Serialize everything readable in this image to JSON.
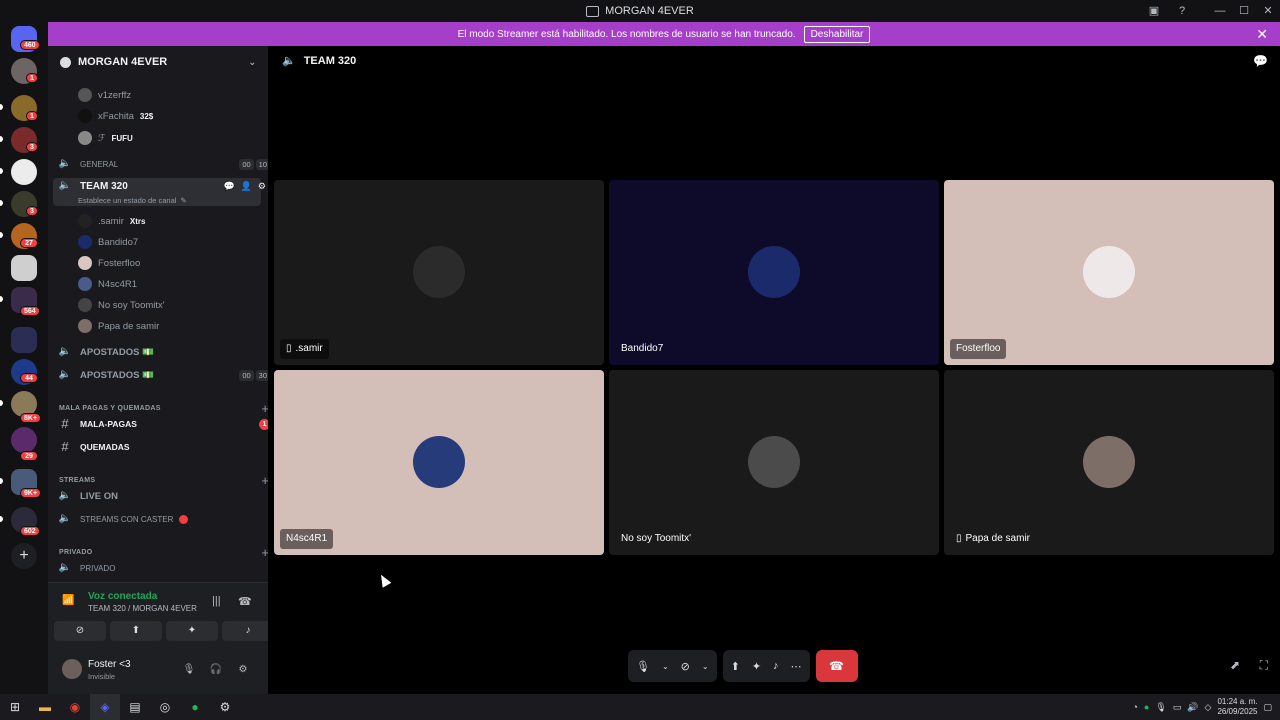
{
  "window": {
    "title": "MORGAN 4EVER"
  },
  "banner": {
    "text": "El modo Streamer está habilitado. Los nombres de usuario se han truncado.",
    "button": "Deshabilitar"
  },
  "servers": [
    {
      "badge": "460"
    },
    {
      "badge": "1"
    },
    {
      "badge": "1"
    },
    {
      "badge": "3"
    },
    {
      "badge": ""
    },
    {
      "badge": "3"
    },
    {
      "badge": "27"
    },
    {
      "badge": ""
    },
    {
      "badge": "564"
    },
    {
      "badge": ""
    },
    {
      "badge": "44"
    },
    {
      "badge": "8K+"
    },
    {
      "badge": "29"
    },
    {
      "badge": "9K+"
    },
    {
      "badge": "602"
    }
  ],
  "guild": {
    "name": "MORGAN 4EVER"
  },
  "sidebar": {
    "members_top": [
      {
        "name": "v1zerffz",
        "tag": ""
      },
      {
        "name": "xFachita",
        "tag": "32$"
      },
      {
        "name": "ℱ",
        "tag": "FUFU"
      }
    ],
    "general": {
      "name": "GENERAL",
      "c1": "00",
      "c2": "10"
    },
    "team": {
      "name": "TEAM 320",
      "status": "Establece un estado de canal"
    },
    "team_members": [
      {
        "name": ".samir",
        "tag": "Xtrs"
      },
      {
        "name": "Bandido7",
        "tag": ""
      },
      {
        "name": "Fosterfloo",
        "tag": ""
      },
      {
        "name": "N4sc4R1",
        "tag": ""
      },
      {
        "name": "No soy Toomitx'",
        "tag": ""
      },
      {
        "name": "Papa de samir",
        "tag": ""
      }
    ],
    "apostados1": "APOSTADOS 💵",
    "apostados2": {
      "name": "APOSTADOS 💵",
      "c1": "00",
      "c2": "30"
    },
    "cat_mala": "MALA PAGAS Y QUEMADAS",
    "mala_pagas": {
      "name": "MALA-PAGAS",
      "badge": "1"
    },
    "quemadas": "QUEMADAS",
    "cat_streams": "STREAMS",
    "live_on": "LIVE ON",
    "streams_caster": "STREAMS CON CASTER",
    "cat_privado": "PRIVADO",
    "privado": "PRIVADO"
  },
  "voice": {
    "status": "Voz conectada",
    "location": "TEAM 320 / MORGAN 4EVER"
  },
  "user": {
    "name": "Foster <3",
    "status": "Invisible"
  },
  "stage": {
    "channel": "TEAM 320"
  },
  "tiles": [
    {
      "name": ".samir",
      "bg": "#1a1a1a",
      "avatar": "#2b2b2b",
      "mobile": true
    },
    {
      "name": "Bandido7",
      "bg": "#0e0b2a",
      "avatar": "#1b2a6a",
      "mobile": false
    },
    {
      "name": "Fosterfloo",
      "bg": "#d4bfb8",
      "avatar": "#efe8e8",
      "mobile": false
    },
    {
      "name": "N4sc4R1",
      "bg": "#d4bfb8",
      "avatar": "#263b7a",
      "mobile": false
    },
    {
      "name": "No soy Toomitx'",
      "bg": "#1a1a1a",
      "avatar": "#4b4b4b",
      "mobile": false
    },
    {
      "name": "Papa de samir",
      "bg": "#1a1a1a",
      "avatar": "#7e6e68",
      "mobile": true
    }
  ],
  "tray": {
    "time": "01:24 a. m.",
    "date": "26/09/2025"
  },
  "colors": {
    "banner": "#a53fc9",
    "accent_green": "#23a55a",
    "danger": "#da373c"
  }
}
